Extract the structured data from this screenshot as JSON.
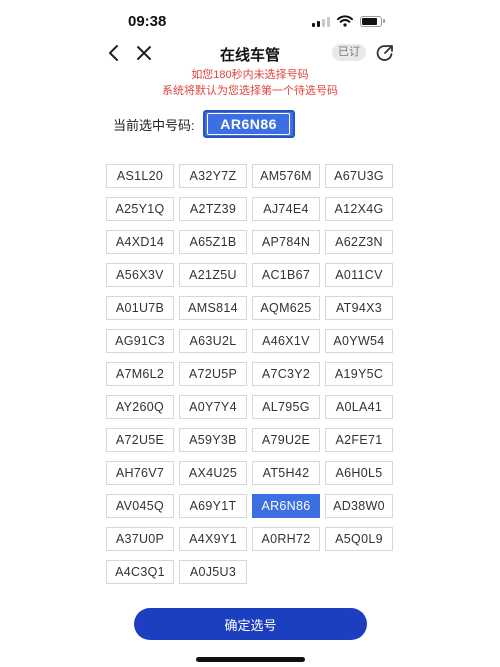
{
  "status_bar": {
    "time": "09:38",
    "icons": [
      "signal-icon",
      "wifi-icon",
      "battery-icon"
    ]
  },
  "nav": {
    "title": "在线车管",
    "subscribed_badge": "已订",
    "icons": [
      "back-icon",
      "close-icon",
      "share-icon"
    ]
  },
  "notice": {
    "line1": "如您180秒内未选择号码",
    "line2": "系统将默认为您选择第一个待选号码",
    "color": "#e0443d"
  },
  "selection": {
    "label": "当前选中号码:",
    "value": "AR6N86"
  },
  "plates": [
    "AS1L20",
    "A32Y7Z",
    "AM576M",
    "A67U3G",
    "A25Y1Q",
    "A2TZ39",
    "AJ74E4",
    "A12X4G",
    "A4XD14",
    "A65Z1B",
    "AP784N",
    "A62Z3N",
    "A56X3V",
    "A21Z5U",
    "AC1B67",
    "A011CV",
    "A01U7B",
    "AMS814",
    "AQM625",
    "AT94X3",
    "AG91C3",
    "A63U2L",
    "A46X1V",
    "A0YW54",
    "A7M6L2",
    "A72U5P",
    "A7C3Y2",
    "A19Y5C",
    "AY260Q",
    "A0Y7Y4",
    "AL795G",
    "A0LA41",
    "A72U5E",
    "A59Y3B",
    "A79U2E",
    "A2FE71",
    "AH76V7",
    "AX4U25",
    "AT5H42",
    "A6H0L5",
    "AV045Q",
    "A69Y1T",
    "AR6N86",
    "AD38W0",
    "A37U0P",
    "A4X9Y1",
    "A0RH72",
    "A5Q0L9",
    "A4C3Q1",
    "A0J5U3"
  ],
  "confirm_button": "确定选号",
  "colors": {
    "accent": "#3d6fe3",
    "button": "#1c3fbf"
  }
}
